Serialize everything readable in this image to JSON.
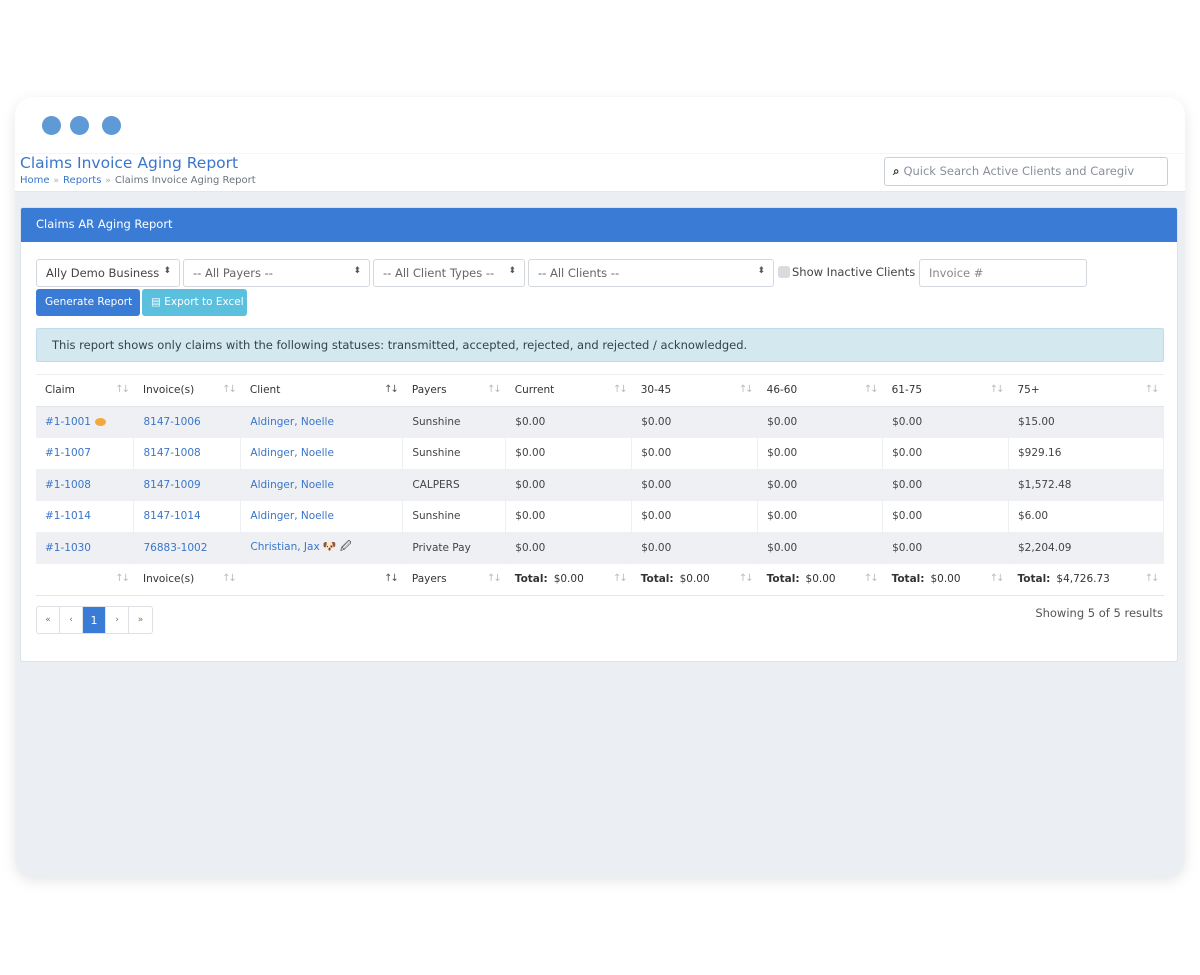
{
  "window": {
    "controls": [
      "window-dot",
      "window-dot",
      "window-dot"
    ],
    "accent": "#5e9ad6"
  },
  "header": {
    "title": "Claims Invoice Aging Report",
    "breadcrumb": [
      "Home",
      "Reports",
      "Claims Invoice Aging Report"
    ],
    "breadcrumb_sep": "»",
    "search_icon": "search-icon",
    "search_glyph": "🔍",
    "search_placeholder": "Quick Search Active Clients and Caregiv"
  },
  "panel": {
    "title": "Claims AR Aging Report",
    "filters": {
      "business": "Ally Demo Business",
      "payers": "-- All Payers --",
      "client_types": "-- All Client Types --",
      "clients": "-- All Clients --",
      "show_inactive_label": "Show Inactive Clients",
      "show_inactive_checked": false,
      "invoice_placeholder": "Invoice #",
      "caret": "⬍"
    },
    "buttons": {
      "generate": "Generate Report",
      "export": "Export to Excel",
      "export_icon": "▤"
    },
    "alert": "This report shows only claims with the following statuses: transmitted, accepted, rejected, and rejected / acknowledged.",
    "colors": {
      "primary": "#3a7bd5",
      "info": "#5bc0de",
      "alert_bg": "#d3e8ef",
      "link": "#3a76c9"
    }
  },
  "table": {
    "sort_glyph": "↑↓",
    "columns": [
      "Claim",
      "Invoice(s)",
      "Client",
      "Payers",
      "Current",
      "30-45",
      "46-60",
      "61-75",
      "75+"
    ],
    "rows": [
      {
        "claim": "#1-1001",
        "has_comment": true,
        "invoice": "8147-1006",
        "client": "Aldinger, Noelle",
        "client_icons": "",
        "payer": "Sunshine",
        "current": "$0.00",
        "d30_45": "$0.00",
        "d46_60": "$0.00",
        "d61_75": "$0.00",
        "d75p": "$15.00"
      },
      {
        "claim": "#1-1007",
        "has_comment": false,
        "invoice": "8147-1008",
        "client": "Aldinger, Noelle",
        "client_icons": "",
        "payer": "Sunshine",
        "current": "$0.00",
        "d30_45": "$0.00",
        "d46_60": "$0.00",
        "d61_75": "$0.00",
        "d75p": "$929.16"
      },
      {
        "claim": "#1-1008",
        "has_comment": false,
        "invoice": "8147-1009",
        "client": "Aldinger, Noelle",
        "client_icons": "",
        "payer": "CALPERS",
        "current": "$0.00",
        "d30_45": "$0.00",
        "d46_60": "$0.00",
        "d61_75": "$0.00",
        "d75p": "$1,572.48"
      },
      {
        "claim": "#1-1014",
        "has_comment": false,
        "invoice": "8147-1014",
        "client": "Aldinger, Noelle",
        "client_icons": "",
        "payer": "Sunshine",
        "current": "$0.00",
        "d30_45": "$0.00",
        "d46_60": "$0.00",
        "d61_75": "$0.00",
        "d75p": "$6.00"
      },
      {
        "claim": "#1-1030",
        "has_comment": false,
        "invoice": "76883-1002",
        "client": "Christian, Jax",
        "client_icons": "🐶 🖉",
        "payer": "Private Pay",
        "current": "$0.00",
        "d30_45": "$0.00",
        "d46_60": "$0.00",
        "d61_75": "$0.00",
        "d75p": "$2,204.09"
      }
    ],
    "footer": {
      "invoice": "Invoice(s)",
      "payers": "Payers",
      "total_label": "Total:",
      "current": "$0.00",
      "d30_45": "$0.00",
      "d46_60": "$0.00",
      "d61_75": "$0.00",
      "d75p": "$4,726.73"
    }
  },
  "pagination": {
    "first": "«",
    "prev": "‹",
    "current": "1",
    "next": "›",
    "last": "»",
    "showing": "Showing 5 of 5 results"
  }
}
